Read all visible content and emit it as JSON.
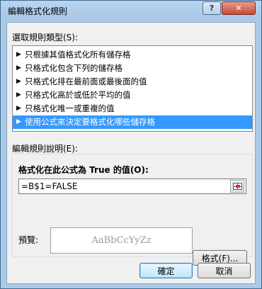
{
  "window": {
    "title": "編輯格式化規則"
  },
  "titlebar": {
    "help_label": "?",
    "close_label": "✕"
  },
  "rule_type": {
    "label": "選取規則類型(S):",
    "items": [
      "只根據其值格式化所有儲存格",
      "只格式化包含下列的儲存格",
      "只格式化排在最前面或最後面的值",
      "只格式化高於或低於平均的值",
      "只格式化唯一或重複的值",
      "使用公式來決定要格式化哪些儲存格"
    ],
    "selected_index": 5
  },
  "edit": {
    "label": "編輯規則說明(E):",
    "formula_label": "格式化在此公式為 True 的值(O):",
    "formula_value": "=B$1=FALSE",
    "preview_label": "預覽:",
    "preview_sample": "AaBbCcYyZz",
    "format_button": "格式(F)..."
  },
  "footer": {
    "ok": "確定",
    "cancel": "取消"
  },
  "colors": {
    "selected": "#3399ff",
    "titlebar": "#aacbe8"
  }
}
